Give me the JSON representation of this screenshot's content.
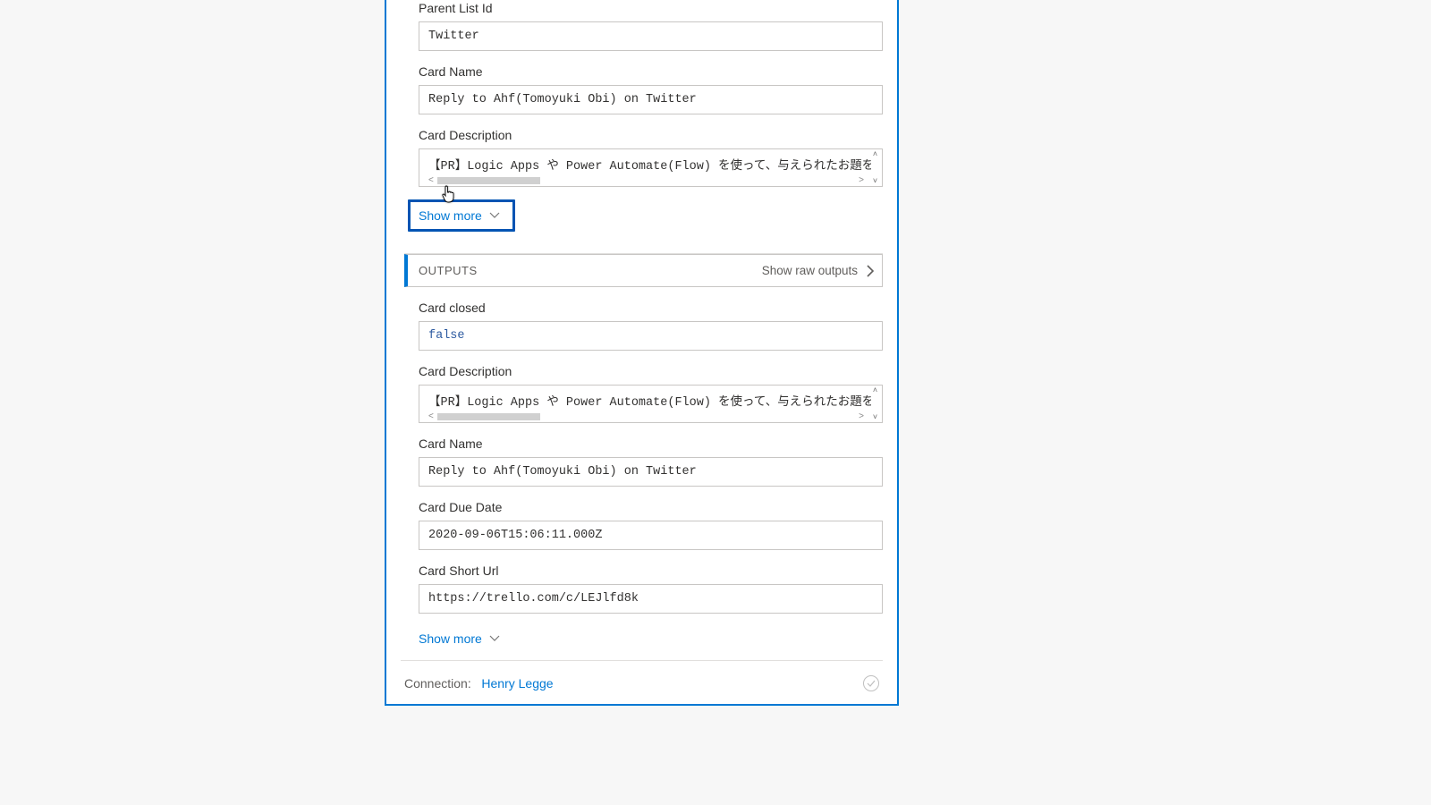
{
  "inputs": {
    "parent_list_id_label": "Parent List Id",
    "parent_list_id_value": "Twitter",
    "card_name_label": "Card Name",
    "card_name_value": "Reply to Ahf(Tomoyuki Obi) on Twitter",
    "card_description_label": "Card Description",
    "card_description_value": "【PR】Logic Apps や Power Automate(Flow) を使って、与えられたお題を",
    "show_more_label": "Show more"
  },
  "outputs": {
    "header_title": "OUTPUTS",
    "raw_link_label": "Show raw outputs",
    "card_closed_label": "Card closed",
    "card_closed_value": "false",
    "card_description_label": "Card Description",
    "card_description_value": "【PR】Logic Apps や Power Automate(Flow) を使って、与えられたお題を",
    "card_name_label": "Card Name",
    "card_name_value": "Reply to Ahf(Tomoyuki Obi) on Twitter",
    "card_due_date_label": "Card Due Date",
    "card_due_date_value": "2020-09-06T15:06:11.000Z",
    "card_short_url_label": "Card Short Url",
    "card_short_url_value": "https://trello.com/c/LEJlfd8k",
    "show_more_label": "Show more"
  },
  "footer": {
    "connection_label": "Connection:",
    "connection_name": "Henry Legge"
  }
}
